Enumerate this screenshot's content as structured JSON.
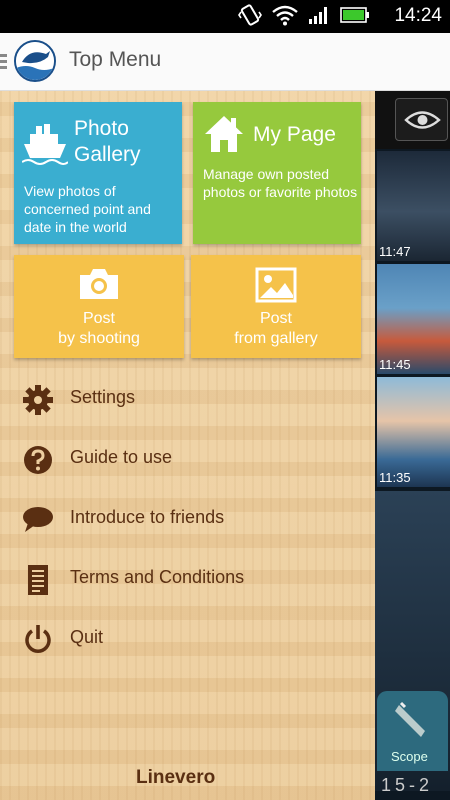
{
  "status_bar": {
    "time": "14:24"
  },
  "app_bar": {
    "title": "Top Menu"
  },
  "tiles": {
    "gallery": {
      "title_line1": "Photo",
      "title_line2": "Gallery",
      "description": "View photos of concerned point and date in the world"
    },
    "my_page": {
      "title": "My Page",
      "description": "Manage own posted photos or favorite photos"
    },
    "shoot": {
      "label": "Post\nby shooting"
    },
    "from_gallery": {
      "label": "Post\nfrom gallery"
    }
  },
  "menu": {
    "items": [
      {
        "label": "Settings",
        "icon": "gear-icon"
      },
      {
        "label": "Guide to use",
        "icon": "question-icon"
      },
      {
        "label": "Introduce to friends",
        "icon": "speech-bubble-icon"
      },
      {
        "label": "Terms and Conditions",
        "icon": "document-icon"
      },
      {
        "label": "Quit",
        "icon": "power-icon"
      }
    ]
  },
  "brand": {
    "name": "Linevero"
  },
  "feed": {
    "times": [
      "11:47",
      "11:45",
      "11:35"
    ],
    "scope_label": "Scope",
    "bottom_number": "15-2"
  },
  "colors": {
    "gallery_tile": "#3aaed0",
    "my_page_tile": "#96c93d",
    "post_tiles": "#f5c24a",
    "menu_text": "#5a2f12"
  }
}
